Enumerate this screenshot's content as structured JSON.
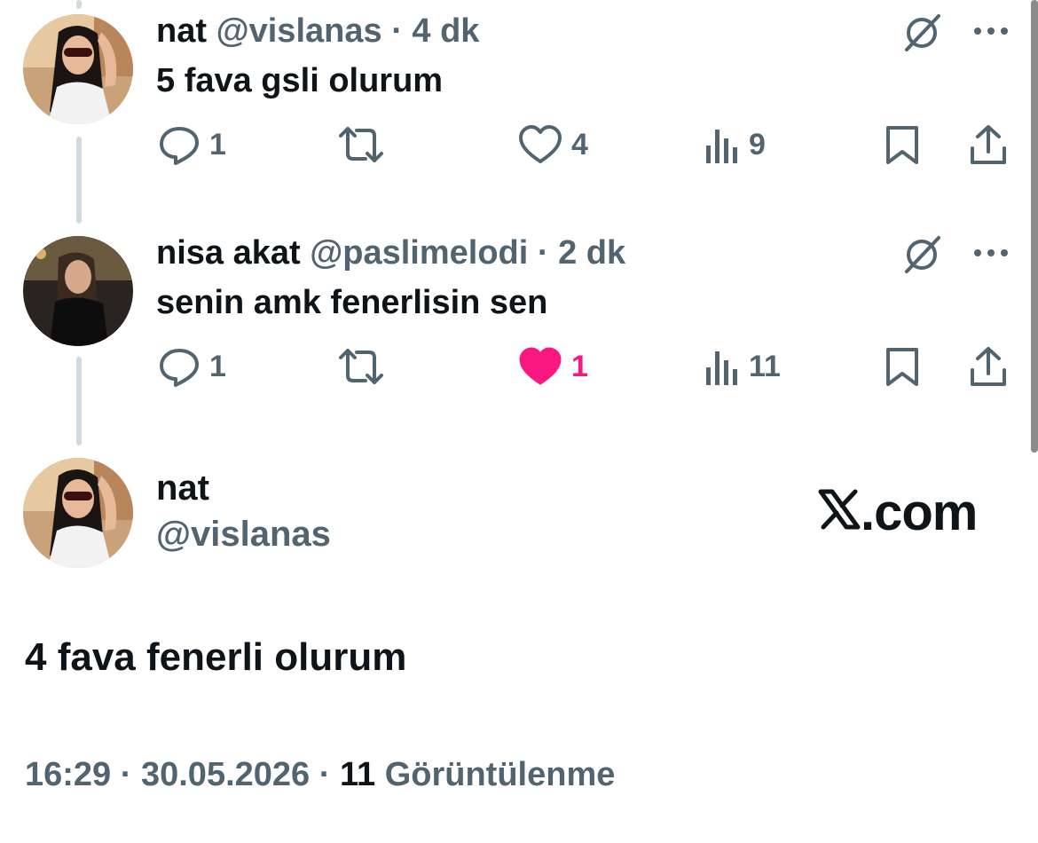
{
  "reply1": {
    "name": "nat",
    "handle": "@vislanas",
    "separator": "·",
    "time": "4 dk",
    "text": "5 fava gsli olurum",
    "replies": "1",
    "likes": "4",
    "views": "9"
  },
  "reply2": {
    "name": "nisa akat",
    "handle": "@paslimelodi",
    "separator": "·",
    "time": "2 dk",
    "text": "senin amk fenerlisin sen",
    "replies": "1",
    "likes": "1",
    "views": "11"
  },
  "main": {
    "name": "nat",
    "handle": "@vislanas",
    "brand": ".com",
    "text": "4 fava fenerli olurum",
    "time": "16:29",
    "date": "30.05.2026",
    "separator": "·",
    "views": "11",
    "views_label": "Görüntülenme"
  },
  "colors": {
    "text": "#0f1419",
    "secondary": "#536471",
    "like": "#f91880",
    "thread_line": "#cfd9de"
  },
  "icons": [
    "reply-icon",
    "retweet-icon",
    "like-icon",
    "views-icon",
    "bookmark-icon",
    "share-icon",
    "grok-icon",
    "more-icon",
    "x-logo-icon"
  ]
}
